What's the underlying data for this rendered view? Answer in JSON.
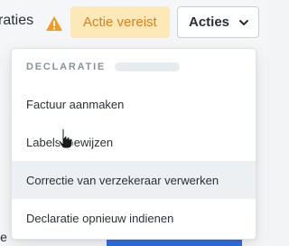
{
  "topbar": {
    "truncated_label": "raties",
    "status_badge": "Actie vereist",
    "actions_button": "Acties"
  },
  "menu": {
    "header": "DECLARATIE",
    "items": [
      {
        "label": "Factuur aanmaken"
      },
      {
        "label": "Labels toewijzen"
      },
      {
        "label": "Correctie van verzekeraar verwerken"
      },
      {
        "label": "Declaratie opnieuw indienen"
      }
    ]
  },
  "background": {
    "partial_text": "ie"
  },
  "colors": {
    "warning": "#f59a1e",
    "badge_bg": "#fde9b8",
    "badge_text": "#e07e18",
    "hover_bg": "#edf0f3",
    "primary": "#2f6fe0"
  },
  "icons": {
    "warning": "warning-triangle-icon",
    "chevron": "chevron-down-icon",
    "cursor": "hand-pointer-icon"
  }
}
